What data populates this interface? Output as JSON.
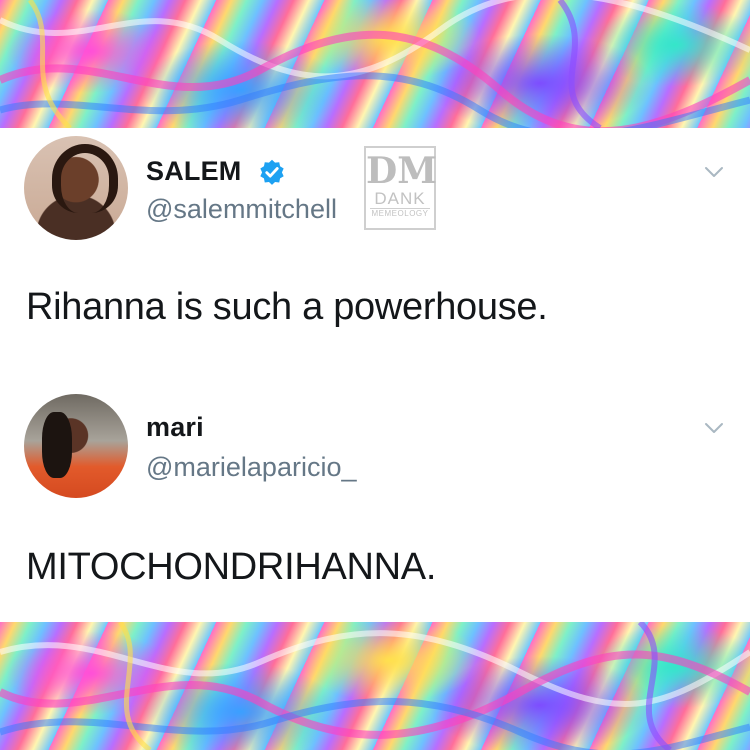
{
  "tweets": [
    {
      "display_name": "SALEM",
      "handle": "@salemmitchell",
      "verified": true,
      "text": "Rihanna is such a powerhouse."
    },
    {
      "display_name": "mari",
      "handle": "@marielaparicio_",
      "verified": false,
      "text": "MITOCHONDRIHANNA."
    }
  ],
  "watermark": {
    "logo": "DM",
    "name": "DANK",
    "sub": "MEMEOLOGY"
  },
  "icons": {
    "verified": "verified-badge-icon",
    "menu": "chevron-down-icon"
  },
  "colors": {
    "verified_blue": "#1da1f2",
    "handle_gray": "#657786",
    "text": "#14171a"
  }
}
